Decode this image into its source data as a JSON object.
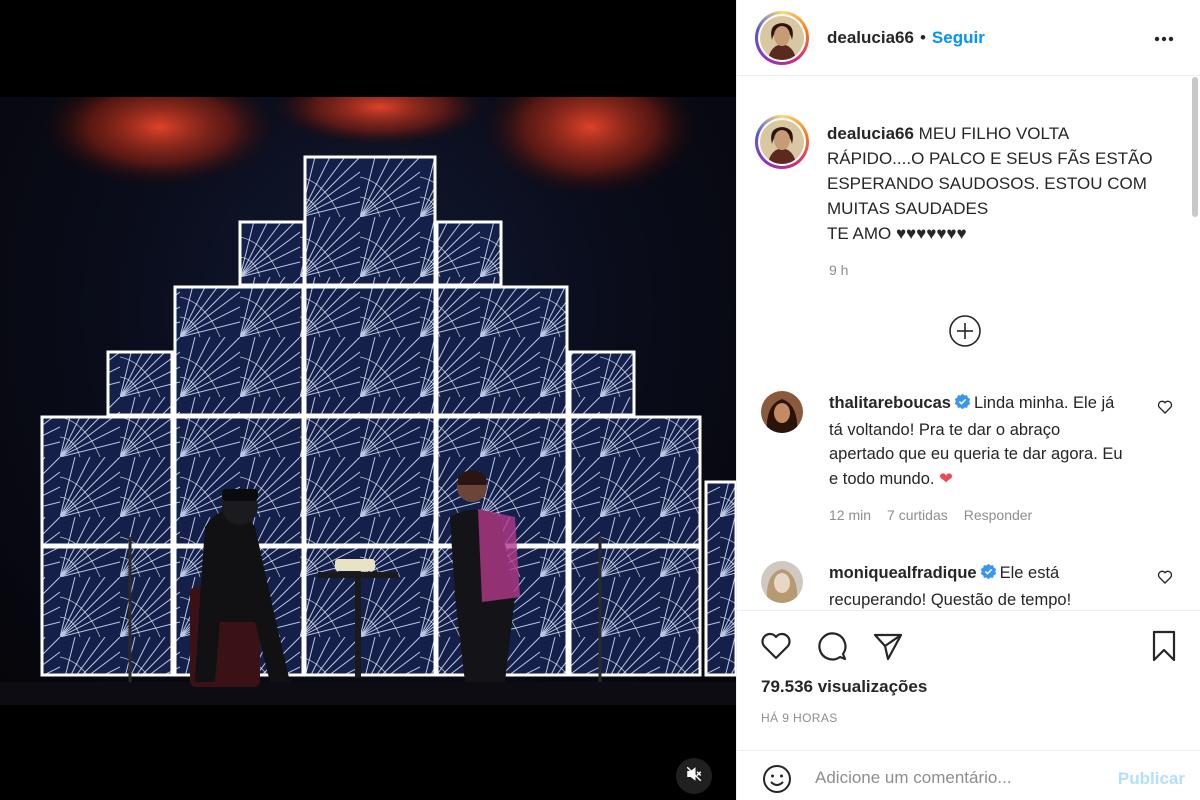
{
  "post": {
    "username": "dealucia66",
    "dot": "•",
    "follow_label": "Seguir",
    "more_icon": "more-horizontal-icon"
  },
  "caption": {
    "username": "dealucia66",
    "text": " MEU FILHO VOLTA RÁPIDO....O PALCO E SEUS FÃS ESTÃO ESPERANDO SAUDOSOS. ESTOU COM MUITAS SAUDADES\nTE AMO ♥♥♥♥♥♥♥",
    "time": "9 h"
  },
  "comments": [
    {
      "username": "thalitareboucas",
      "verified": true,
      "text": "Linda minha. Ele já tá voltando! Pra te dar o abraço apertado que eu queria te dar agora. Eu e todo mundo. ",
      "emoji": "❤",
      "time": "12 min",
      "likes": "7 curtidas",
      "reply_label": "Responder"
    },
    {
      "username": "moniquealfradique",
      "verified": true,
      "text": "Ele está recuperando! Questão de tempo!"
    }
  ],
  "actions": {
    "views": "79.536 visualizações",
    "time_ago": "HÁ 9 HORAS"
  },
  "comment_box": {
    "placeholder": "Adicione um comentário...",
    "publish_label": "Publicar"
  },
  "colors": {
    "accent": "#0095f6",
    "publish_disabled": "#b2dffc",
    "heart_red": "#ed4956",
    "muted_text": "#8e8e8e",
    "verified_blue": "#3897f0"
  }
}
